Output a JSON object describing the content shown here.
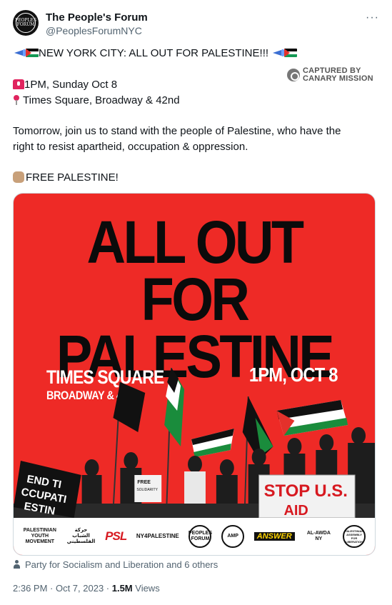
{
  "account": {
    "name": "The People's Forum",
    "handle": "@PeoplesForumNYC",
    "avatar_text": "PEOPLES FORUM",
    "more_label": "···"
  },
  "tweet": {
    "headline": "NEW YORK CITY: ALL OUT FOR PALESTINE!!!",
    "time": "1PM, Sunday Oct 8",
    "location": "Times Square, Broadway & 42nd",
    "body_line1": "Tomorrow, join us to stand with the people of Palestine, who have the",
    "body_line2": "right to resist apartheid, occupation & oppression.",
    "closing": "FREE PALESTINE!"
  },
  "watermark": {
    "line1": "CAPTURED BY",
    "line2": "CANARY MISSION"
  },
  "poster": {
    "headline_line1": "ALL OUT FOR",
    "headline_line2": "PALESTINE",
    "place": "TIMES SQUARE",
    "street": "BROADWAY & 42ST",
    "time": "1PM, OCT 8",
    "signs": [
      "END TI",
      "CCUPATI",
      "ESTIN",
      "STOP U.S.",
      "AID",
      "FREE",
      "SOLIDARITY"
    ],
    "logos": [
      "PALESTINIAN YOUTH MOVEMENT",
      "حركة الشباب الفلسطيني",
      "PSL",
      "NY4PALESTINE",
      "PEOPLES FORUM",
      "AMP",
      "ANSWER",
      "AL-AWDA NY",
      "PALESTINIAN ASSEMBLY FOR LIBERATION"
    ]
  },
  "social_context": "Party for Socialism and Liberation and 6 others",
  "meta": {
    "timestamp": "2:36 PM · Oct 7, 2023 · ",
    "views_count": "1.5M",
    "views_label": " Views"
  },
  "colors": {
    "poster_red": "#ee2a26",
    "text_primary": "#0f1419",
    "text_secondary": "#536471"
  }
}
